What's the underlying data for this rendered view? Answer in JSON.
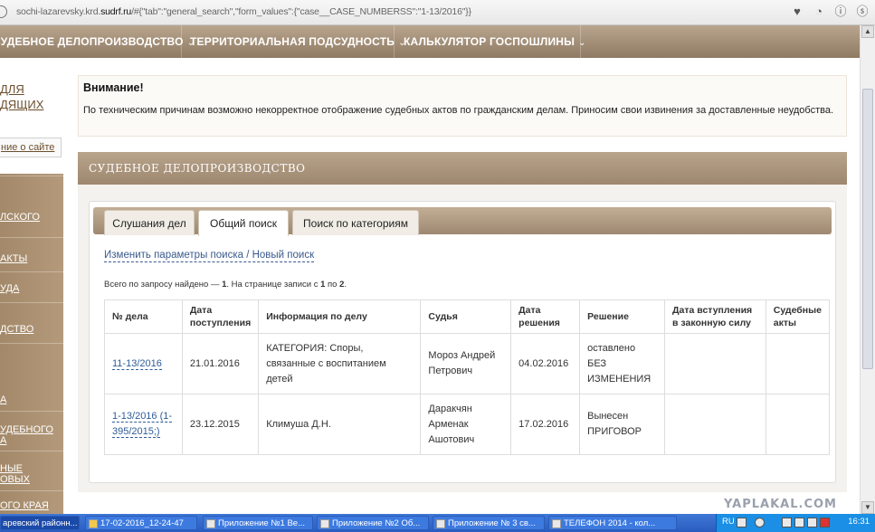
{
  "browser": {
    "url_prefix": "sochi-lazarevsky.krd.",
    "url_domain": "sudrf.ru",
    "url_rest": "/#{\"tab\":\"general_search\",\"form_values\":{\"case__CASE_NUMBERSS\":\"1-13/2016\"}}",
    "buttons": [
      "♥",
      "◔",
      "ⓘ",
      "ⓢ"
    ]
  },
  "topnav": {
    "items": [
      {
        "label": "СУДЕБНОЕ ДЕЛОПРОИЗВОДСТВО"
      },
      {
        "label": "ТЕРРИТОРИАЛЬНАЯ ПОДСУДНОСТЬ"
      },
      {
        "label": "КАЛЬКУЛЯТОР ГОСПОШЛИНЫ"
      }
    ],
    "chevron": "⌄"
  },
  "sidebar": {
    "top_link": "ДЛЯ\nЛЯЩИХ",
    "top_link_line1": "ДЛЯ",
    "top_link_line2": "ДЯЩИХ",
    "about": "ние о сайте",
    "menu": [
      {
        "label": "ЛСКОГО"
      },
      {
        "label": "АКТЫ"
      },
      {
        "label": "УДА"
      },
      {
        "label": "ДСТВО"
      },
      {
        "label": "А"
      },
      {
        "label": "УДЕБНОГО"
      },
      {
        "label": "А"
      },
      {
        "label": "НЫЕ"
      },
      {
        "label": "ОВЫХ"
      },
      {
        "label": "ОГО КРАЯ"
      }
    ]
  },
  "notice": {
    "title": "Внимание!",
    "text": "По техническим причинам возможно некорректное отображение судебных актов по гражданским делам. Приносим свои извинения за доставленные неудобства."
  },
  "section": {
    "title": "СУДЕБНОЕ ДЕЛОПРОИЗВОДСТВО",
    "tabs": [
      {
        "label": "Слушания дел"
      },
      {
        "label": "Общий поиск"
      },
      {
        "label": "Поиск по категориям"
      }
    ],
    "change_link": "Изменить параметры поиска / Новый поиск",
    "found_prefix": "Всего по запросу найдено — ",
    "found_count": "1",
    "found_mid": ". На странице записи с ",
    "found_from": "1",
    "found_to_label": " по ",
    "found_to": "2",
    "found_end": "."
  },
  "table": {
    "headers": [
      "№ дела",
      "Дата поступления",
      "Информация по делу",
      "Судья",
      "Дата решения",
      "Решение",
      "Дата вступления в законную силу",
      "Судебные акты"
    ],
    "rows": [
      {
        "case": "11-13/2016",
        "received": "21.01.2016",
        "info": "КАТЕГОРИЯ: Споры, связанные с воспитанием детей",
        "judge": "Мороз Андрей Петрович",
        "decision_date": "04.02.2016",
        "decision": "оставлено БЕЗ ИЗМЕНЕНИЯ",
        "effective": "",
        "acts": ""
      },
      {
        "case": "1-13/2016 (1-395/2015;)",
        "received": "23.12.2015",
        "info": "Климуша Д.Н.",
        "judge": "Даракчян Арменак Ашотович",
        "decision_date": "17.02.2016",
        "decision": "Вынесен ПРИГОВОР",
        "effective": "",
        "acts": ""
      }
    ]
  },
  "watermark": "YAPLAKAL.COM",
  "taskbar": {
    "items": [
      {
        "label": "аревский районн..."
      },
      {
        "label": "17-02-2016_12-24-47"
      },
      {
        "label": "Приложение №1 Ве..."
      },
      {
        "label": "Приложение №2 Об..."
      },
      {
        "label": "Приложение № 3 св..."
      },
      {
        "label": "ТЕЛЕФОН 2014 - кол..."
      }
    ],
    "lang": "RU",
    "clock": "16:31"
  }
}
